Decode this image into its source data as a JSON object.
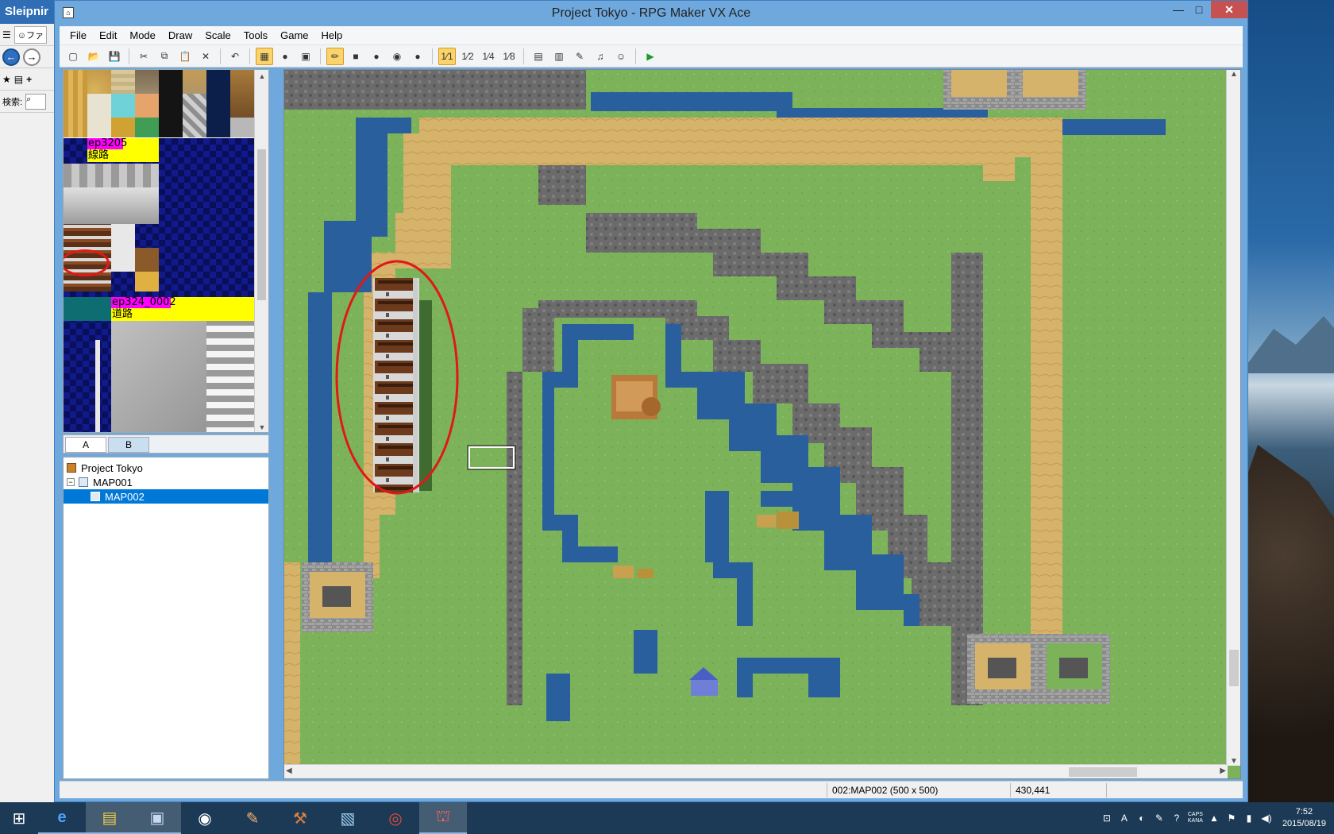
{
  "sleipnir": {
    "title": "Sleipnir",
    "tab_label": "ファ",
    "search_label": "検索:"
  },
  "window": {
    "title": "Project Tokyo - RPG Maker VX Ace",
    "minimize": "—",
    "maximize": "□",
    "close": "✕"
  },
  "menu": [
    "File",
    "Edit",
    "Mode",
    "Draw",
    "Scale",
    "Tools",
    "Game",
    "Help"
  ],
  "toolbar": {
    "icons": [
      "new-project-icon",
      "open-project-icon",
      "save-project-icon",
      "cut-icon",
      "copy-icon",
      "paste-icon",
      "delete-icon",
      "undo-icon",
      "map-layer-icon",
      "event-layer-icon",
      "region-layer-icon",
      "pencil-icon",
      "rectangle-icon",
      "ellipse-icon",
      "flood-fill-icon",
      "shadow-pen-icon",
      "scale-1-1-icon",
      "scale-1-2-icon",
      "scale-1-4-icon",
      "scale-1-8-icon",
      "database-icon",
      "resource-manager-icon",
      "script-editor-icon",
      "sound-test-icon",
      "character-generator-icon",
      "playtest-icon"
    ],
    "glyphs": [
      "▢",
      "📂",
      "💾",
      "✂",
      "⧉",
      "📋",
      "✕",
      "↶",
      "▦",
      "●",
      "▣",
      "✏",
      "■",
      "●",
      "◉",
      "●",
      "1⁄1",
      "1⁄2",
      "1⁄4",
      "1⁄8",
      "▤",
      "▥",
      "✎",
      "♫",
      "☺",
      "▶"
    ],
    "active": [
      8,
      11,
      16
    ]
  },
  "tileset": {
    "labels": [
      "ep3205",
      "線路",
      "ep324_0002",
      "道路"
    ],
    "tabs": [
      "A",
      "B"
    ],
    "active_tab": "A"
  },
  "map_tree": {
    "project": "Project Tokyo",
    "maps": [
      {
        "name": "MAP001",
        "expanded": true,
        "selected": false
      },
      {
        "name": "MAP002",
        "selected": true
      }
    ]
  },
  "status": {
    "map_info": "002:MAP002 (500 x 500)",
    "coords": "430,441"
  },
  "colors": {
    "grass": "#7cb35a",
    "water": "#2a5f9e",
    "sand": "#d6b36a",
    "rock": "#6b6b6b",
    "highlight": "#e01818",
    "selection": "#0078d7"
  },
  "taskbar": {
    "apps": [
      "start-button",
      "ie-icon",
      "file-explorer-icon",
      "window-icon",
      "steam-icon",
      "paint-icon",
      "tool-icon",
      "notebook-icon",
      "chrome-icon",
      "rpgmaker-icon"
    ],
    "clock_time": "7:52",
    "clock_date": "2015/08/19",
    "ime": "A",
    "caps": "CAPS",
    "kana": "KANA"
  }
}
